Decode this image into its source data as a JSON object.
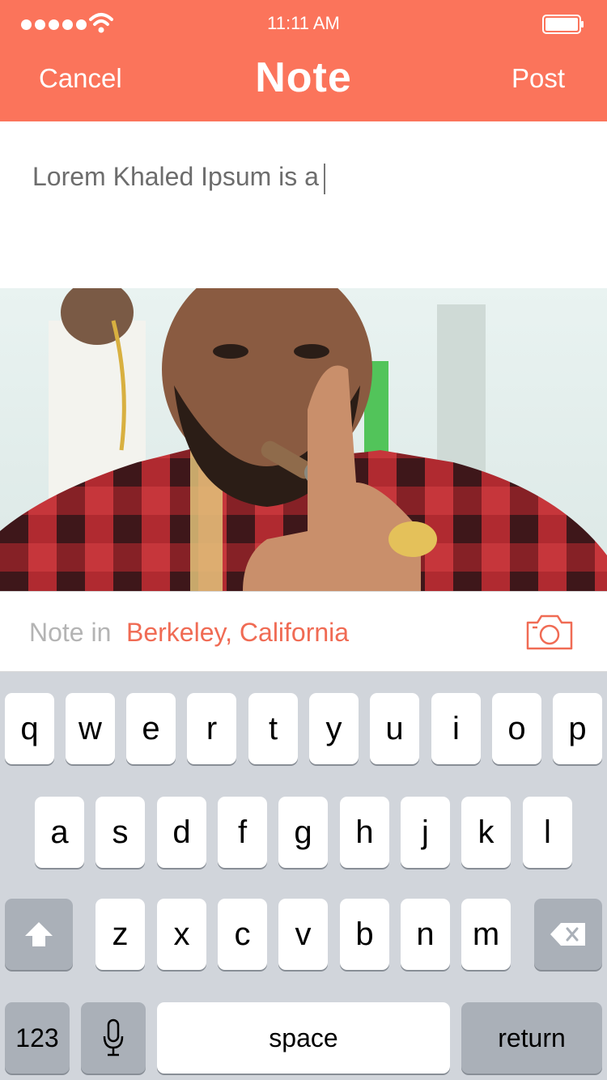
{
  "status_bar": {
    "time": "11:11 AM",
    "signal_icon": "signal-dots-icon",
    "wifi_icon": "wifi-icon",
    "battery_icon": "battery-icon"
  },
  "nav": {
    "cancel_label": "Cancel",
    "title": "Note",
    "post_label": "Post"
  },
  "note": {
    "text": "Lorem Khaled Ipsum is a"
  },
  "location": {
    "prefix": "Note in",
    "place": "Berkeley, California",
    "camera_icon": "camera-icon"
  },
  "keyboard": {
    "row1": [
      "q",
      "w",
      "e",
      "r",
      "t",
      "y",
      "u",
      "i",
      "o",
      "p"
    ],
    "row2": [
      "a",
      "s",
      "d",
      "f",
      "g",
      "h",
      "j",
      "k",
      "l"
    ],
    "row3": [
      "z",
      "x",
      "c",
      "v",
      "b",
      "n",
      "m"
    ],
    "numbers_label": "123",
    "space_label": "space",
    "return_label": "return",
    "shift_icon": "shift-icon",
    "mic_icon": "microphone-icon",
    "delete_icon": "backspace-icon"
  },
  "colors": {
    "accent": "#fb745b",
    "location_accent": "#f06b54"
  }
}
